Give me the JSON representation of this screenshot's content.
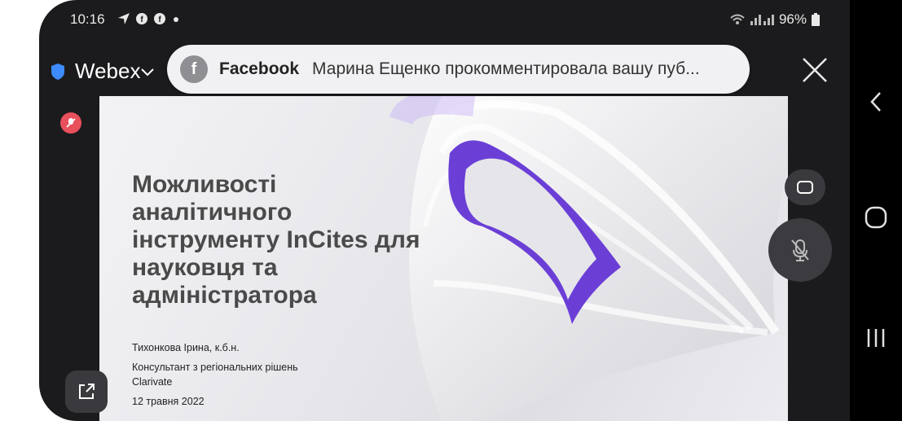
{
  "status_bar": {
    "time": "10:16",
    "battery": "96%"
  },
  "webex": {
    "app_name": "Webex"
  },
  "notification": {
    "app": "Facebook",
    "app_icon_glyph": "f",
    "text": "Марина Ещенко прокомментировала вашу пуб..."
  },
  "slide": {
    "title": "Можливості аналітичного інструменту InCites для науковця та адміністратора",
    "author": "Тихонкова Ірина, к.б.н.",
    "position": "Консультант з регіональних рішень",
    "company": "Clarivate",
    "date": "12 травня 2022"
  },
  "colors": {
    "accent_purple": "#6b3fd6",
    "mute_red": "#e8505b"
  },
  "icons": [
    "navigation-icon",
    "facebook-icon",
    "shield-icon",
    "chevron-down-icon",
    "close-icon",
    "mic-off-icon",
    "window-icon",
    "share-icon",
    "back-icon",
    "home-icon",
    "recents-icon"
  ]
}
